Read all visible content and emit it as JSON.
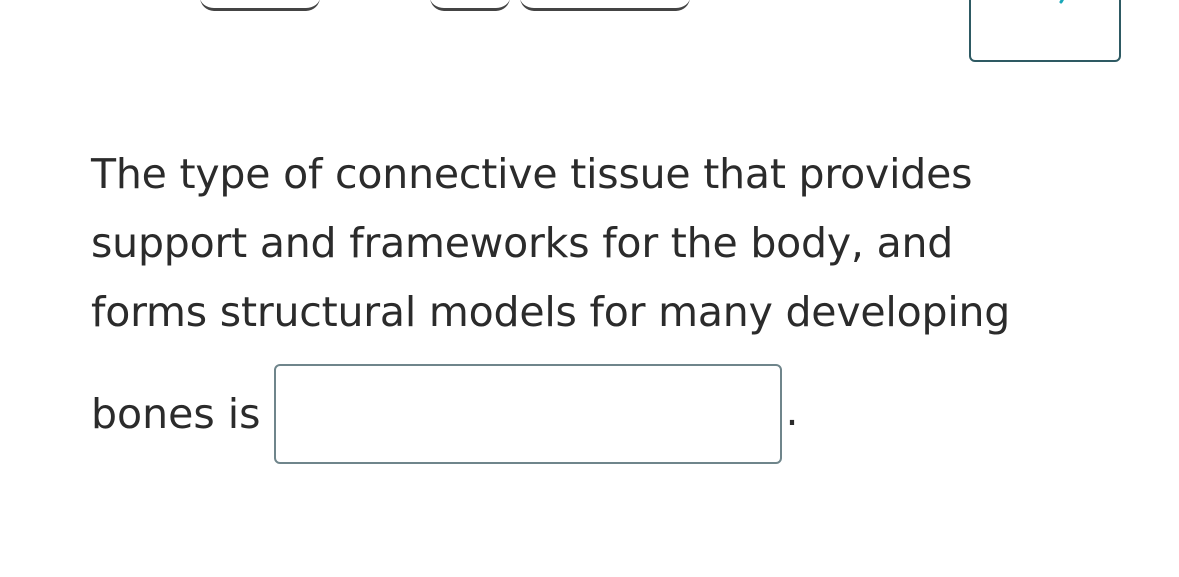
{
  "audio": {
    "icon": "speaker-icon",
    "accent_color": "#1aa7b8"
  },
  "question": {
    "text": "The type of connective tissue that provides support and frameworks for the body, and forms structural models for many developing",
    "prompt_before_blank": "bones is",
    "after_blank": "."
  },
  "answer": {
    "value": "",
    "placeholder": ""
  }
}
